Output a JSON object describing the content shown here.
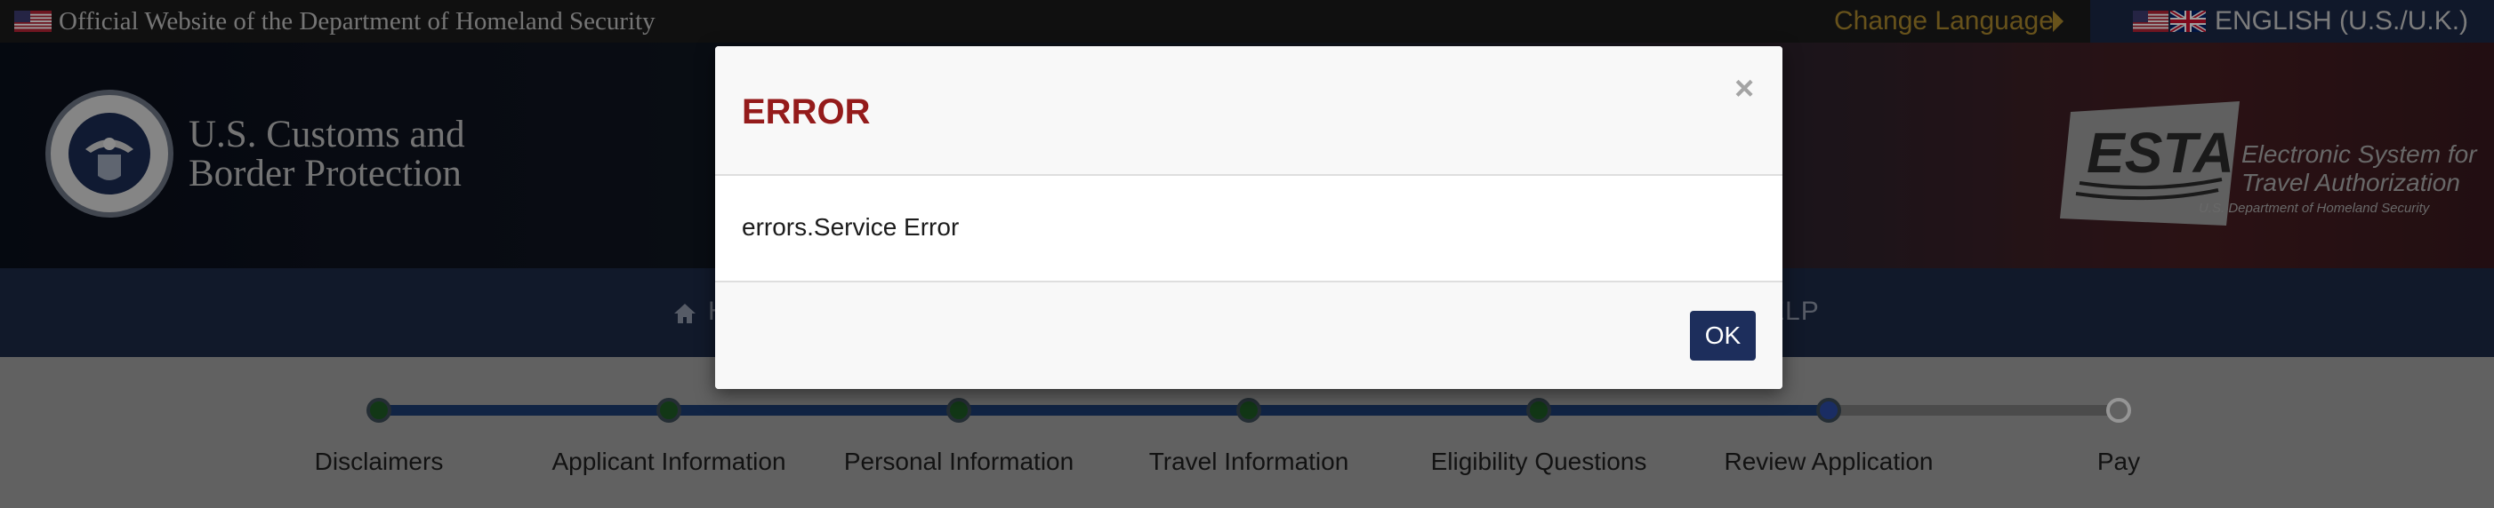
{
  "gov_banner": {
    "text": "Official Website of the Department of Homeland Security",
    "change_language": "Change Language",
    "language": "ENGLISH (U.S./U.K.)"
  },
  "header": {
    "agency_line1": "U.S. Customs and",
    "agency_line2": "Border Protection",
    "esta_logo_text": "ESTA",
    "esta_sub1": "Electronic System for",
    "esta_sub2": "Travel Authorization",
    "esta_dept": "U.S. Department of Homeland Security"
  },
  "nav": {
    "home_label": "H",
    "help_label": "ELP"
  },
  "progress": {
    "steps": [
      {
        "label": "Disclaimers",
        "status": "complete"
      },
      {
        "label": "Applicant Information",
        "status": "complete"
      },
      {
        "label": "Personal Information",
        "status": "complete"
      },
      {
        "label": "Travel Information",
        "status": "complete"
      },
      {
        "label": "Eligibility Questions",
        "status": "complete"
      },
      {
        "label": "Review Application",
        "status": "current"
      },
      {
        "label": "Pay",
        "status": "pending"
      }
    ]
  },
  "modal": {
    "title": "ERROR",
    "close_symbol": "×",
    "message": "errors.Service Error",
    "ok_label": "OK"
  },
  "colors": {
    "error_title": "#941b1b",
    "primary_button": "#1d2e5c",
    "nav_bar": "#1c2945",
    "complete_dot": "#1e5a25",
    "current_dot": "#2a4aa0",
    "track_done": "#1c3a6e",
    "gold": "#a7852c"
  }
}
